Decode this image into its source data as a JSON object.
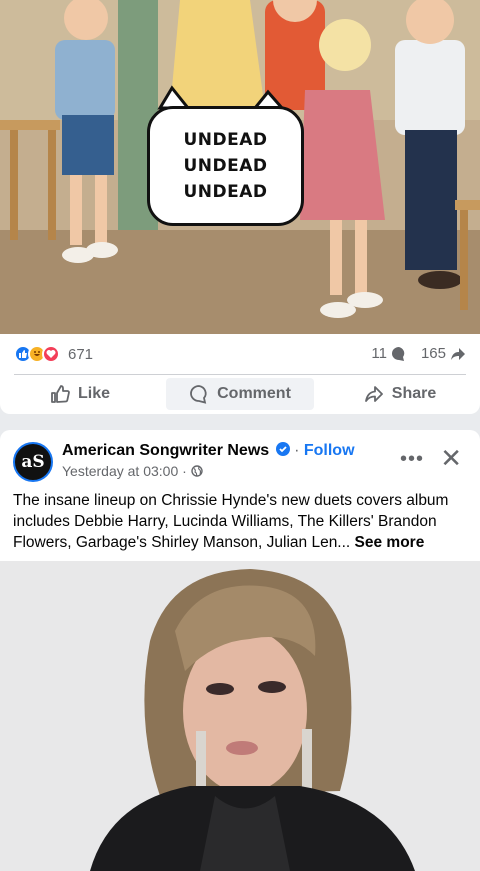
{
  "post1": {
    "speech_lines": [
      "UNDEAD",
      "UNDEAD",
      "UNDEAD"
    ],
    "reaction_count": "671",
    "comment_count": "11",
    "share_count": "165",
    "actions": {
      "like": "Like",
      "comment": "Comment",
      "share": "Share"
    }
  },
  "post2": {
    "avatar_text": "aS",
    "page_name": "American Songwriter News",
    "follow_label": "Follow",
    "timestamp": "Yesterday at 03:00",
    "body": "The insane lineup on Chrissie Hynde's new duets covers album includes Debbie Harry, Lucinda Williams, The Killers' Brandon Flowers, Garbage's Shirley Manson, Julian Len...",
    "see_more": "See more"
  },
  "colors": {
    "accent": "#1877f2",
    "secondary_text": "#65676b",
    "love": "#f33e58",
    "haha": "#f7b125"
  },
  "icons": [
    "like-reaction-icon",
    "haha-reaction-icon",
    "love-reaction-icon",
    "comment-icon",
    "share-arrow-icon",
    "thumbs-up-icon",
    "verified-badge-icon",
    "globe-icon",
    "more-icon",
    "close-icon"
  ]
}
